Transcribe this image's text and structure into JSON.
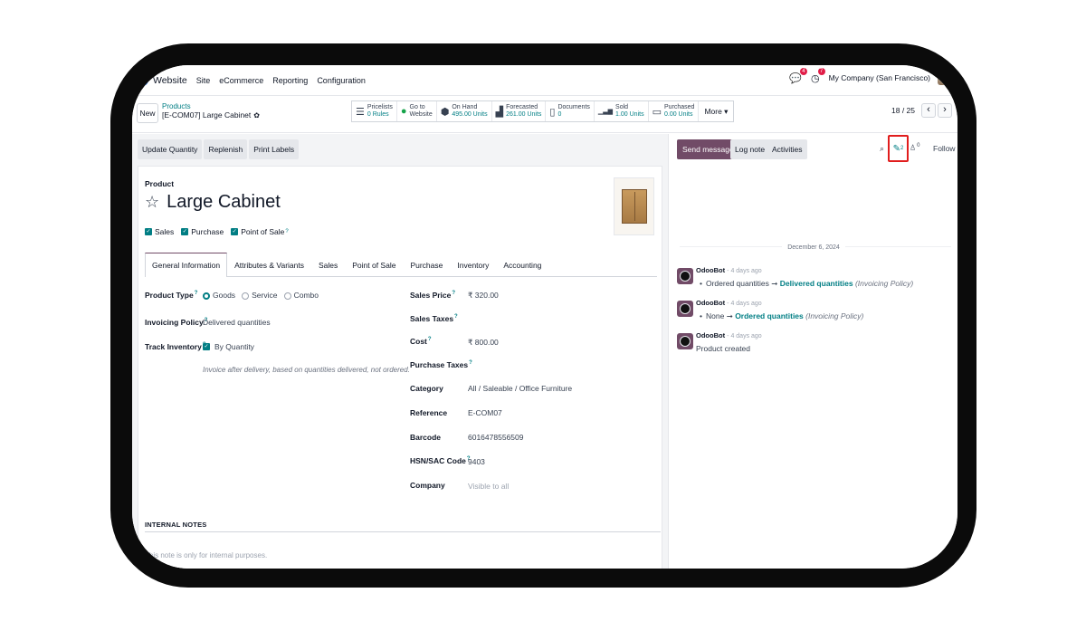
{
  "nav": {
    "brand": "Website",
    "items": [
      "Site",
      "eCommerce",
      "Reporting",
      "Configuration"
    ],
    "messages_count": "4",
    "activities_count": "7",
    "company": "My Company (San Francisco)"
  },
  "control": {
    "new_label": "New",
    "breadcrumb_parent": "Products",
    "breadcrumb_current": "[E-COM07] Large Cabinet",
    "smart_buttons": [
      {
        "icon": "list-icon",
        "glyph": "☰",
        "label": "Pricelists",
        "value": "0 Rules"
      },
      {
        "icon": "globe-icon",
        "glyph": "●",
        "label": "Go to",
        "value": "Website"
      },
      {
        "icon": "cubes-icon",
        "glyph": "⬢",
        "label": "On Hand",
        "value": "495.00 Units"
      },
      {
        "icon": "area-chart-icon",
        "glyph": "▟",
        "label": "Forecasted",
        "value": "261.00 Units"
      },
      {
        "icon": "file-icon",
        "glyph": "▯",
        "label": "Documents",
        "value": "0"
      },
      {
        "icon": "bar-chart-icon",
        "glyph": "▁▃▆",
        "label": "Sold",
        "value": "1.00 Units"
      },
      {
        "icon": "credit-card-icon",
        "glyph": "▭",
        "label": "Purchased",
        "value": "0.00 Units"
      }
    ],
    "more_label": "More ▾",
    "pager": "18 / 25"
  },
  "actions": [
    "Update Quantity",
    "Replenish",
    "Print Labels"
  ],
  "product": {
    "section_label": "Product",
    "name": "Large Cabinet",
    "checks": [
      {
        "label": "Sales",
        "help": false
      },
      {
        "label": "Purchase",
        "help": false
      },
      {
        "label": "Point of Sale",
        "help": true
      }
    ]
  },
  "tabs": [
    "General Information",
    "Attributes & Variants",
    "Sales",
    "Point of Sale",
    "Purchase",
    "Inventory",
    "Accounting"
  ],
  "general": {
    "product_type_label": "Product Type",
    "product_type_options": [
      "Goods",
      "Service",
      "Combo"
    ],
    "invoicing_policy_label": "Invoicing Policy",
    "invoicing_policy_value": "Delivered quantities",
    "track_inventory_label": "Track Inventory",
    "track_inventory_value": "By Quantity",
    "hint": "Invoice after delivery, based on quantities delivered, not ordered.",
    "sales_price_label": "Sales Price",
    "sales_price_value": "₹ 320.00",
    "sales_taxes_label": "Sales Taxes",
    "cost_label": "Cost",
    "cost_value": "₹ 800.00",
    "purchase_taxes_label": "Purchase Taxes",
    "category_label": "Category",
    "category_value": "All / Saleable / Office Furniture",
    "reference_label": "Reference",
    "reference_value": "E-COM07",
    "barcode_label": "Barcode",
    "barcode_value": "6016478556509",
    "hsn_label": "HSN/SAC Code",
    "hsn_value": "9403",
    "company_label": "Company",
    "company_placeholder": "Visible to all",
    "help_mark": "?"
  },
  "notes": {
    "title": "INTERNAL NOTES",
    "placeholder": "This note is only for internal purposes."
  },
  "chatter": {
    "send_message": "Send message",
    "log_note": "Log note",
    "activities": "Activities",
    "attachments_count": "2",
    "followers_count": "0",
    "follow": "Follow",
    "date": "December 6, 2024",
    "messages": [
      {
        "author": "OdooBot",
        "time": "- 4 days ago",
        "bullet": "•",
        "old": "Ordered quantities",
        "arrow": "➞",
        "new": "Delivered quantities",
        "field": "(Invoicing Policy)"
      },
      {
        "author": "OdooBot",
        "time": "- 4 days ago",
        "bullet": "•",
        "old": "None",
        "arrow": "➞",
        "new": "Ordered quantities",
        "field": "(Invoicing Policy)"
      },
      {
        "author": "OdooBot",
        "time": "- 4 days ago",
        "text": "Product created"
      }
    ]
  },
  "colors": {
    "accent": "#714b67",
    "teal": "#017e84",
    "highlight": "#e11d1d"
  }
}
